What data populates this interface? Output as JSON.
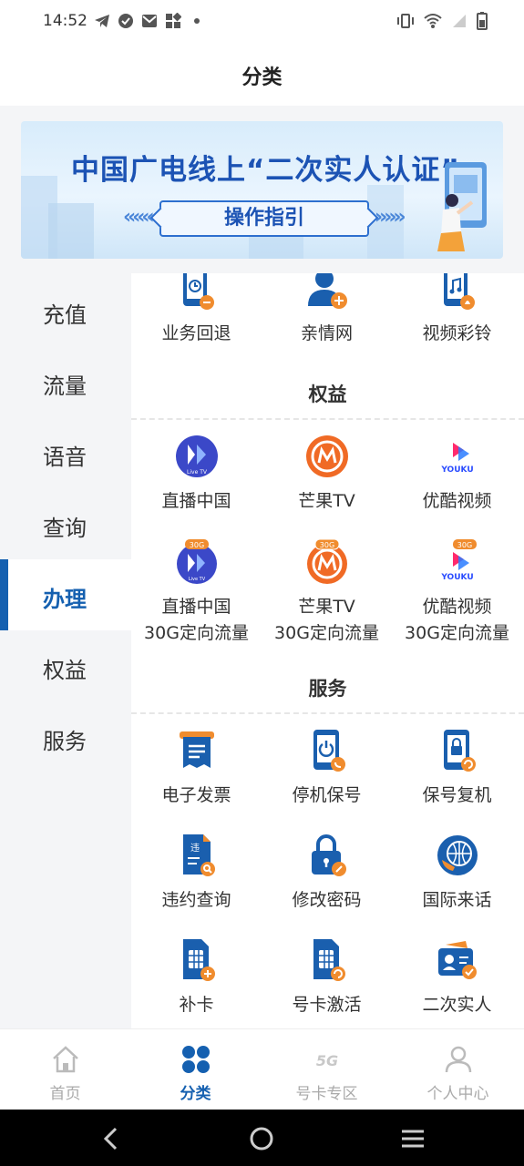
{
  "status_bar": {
    "time": "14:52"
  },
  "header": {
    "title": "分类"
  },
  "banner": {
    "title": "中国广电线上“二次实人认证”",
    "button": "操作指引"
  },
  "sidebar": {
    "items": [
      {
        "label": "充值"
      },
      {
        "label": "流量"
      },
      {
        "label": "语音"
      },
      {
        "label": "查询"
      },
      {
        "label": "办理",
        "active": true
      },
      {
        "label": "权益"
      },
      {
        "label": "服务"
      }
    ]
  },
  "content": {
    "handle_items": [
      {
        "label": "业务回退",
        "icon": "phone-back-icon"
      },
      {
        "label": "亲情网",
        "icon": "family-add-icon"
      },
      {
        "label": "视频彩铃",
        "icon": "video-ringtone-icon"
      }
    ],
    "rights_title": "权益",
    "rights_items": [
      {
        "label": "直播中国",
        "icon": "live-china-icon"
      },
      {
        "label": "芒果TV",
        "icon": "mango-tv-icon"
      },
      {
        "label": "优酷视频",
        "icon": "youku-icon"
      },
      {
        "label": "直播中国",
        "label2": "30G定向流量",
        "icon": "live-china-30g-icon",
        "badge": "30G"
      },
      {
        "label": "芒果TV",
        "label2": "30G定向流量",
        "icon": "mango-tv-30g-icon",
        "badge": "30G"
      },
      {
        "label": "优酷视频",
        "label2": "30G定向流量",
        "icon": "youku-30g-icon",
        "badge": "30G"
      }
    ],
    "live_logo_text": "Live TV",
    "youku_logo_text": "YOUKU",
    "service_title": "服务",
    "service_items": [
      {
        "label": "电子发票",
        "icon": "invoice-icon"
      },
      {
        "label": "停机保号",
        "icon": "suspend-keep-number-icon"
      },
      {
        "label": "保号复机",
        "icon": "resume-service-icon"
      },
      {
        "label": "违约查询",
        "icon": "breach-query-icon"
      },
      {
        "label": "修改密码",
        "icon": "change-password-icon"
      },
      {
        "label": "国际来话",
        "icon": "international-call-icon"
      },
      {
        "label": "补卡",
        "icon": "replace-sim-icon"
      },
      {
        "label": "号卡激活",
        "icon": "activate-sim-icon"
      },
      {
        "label": "二次实人",
        "icon": "real-name-verify-icon"
      }
    ],
    "breach_icon_text": "违"
  },
  "bottom_nav": {
    "items": [
      {
        "label": "首页",
        "icon": "home-icon"
      },
      {
        "label": "分类",
        "icon": "category-icon",
        "active": true
      },
      {
        "label": "号卡专区",
        "icon": "5g-icon",
        "badge": "5G"
      },
      {
        "label": "个人中心",
        "icon": "profile-icon"
      }
    ]
  },
  "colors": {
    "accent": "#1560b0",
    "orange": "#f08c2e",
    "sidebar_bg": "#f4f5f7"
  }
}
